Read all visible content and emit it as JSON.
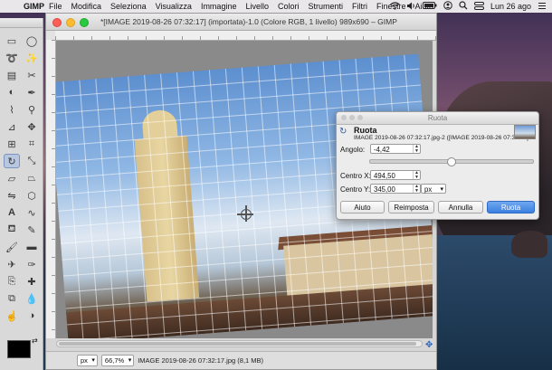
{
  "menubar": {
    "app": "GIMP",
    "items": [
      "File",
      "Modifica",
      "Seleziona",
      "Visualizza",
      "Immagine",
      "Livello",
      "Colori",
      "Strumenti",
      "Filtri",
      "Finestre",
      "Aiuto"
    ],
    "clock": "Lun 26 ago"
  },
  "window": {
    "title": "*[IMAGE 2019-08-26 07:32:17] (importata)-1.0 (Colore RGB, 1 livello) 989x690 – GIMP"
  },
  "statusbar": {
    "unit": "px",
    "zoom": "66,7%",
    "info": "IMAGE 2019-08-26 07:32:17.jpg (8,1 MB)"
  },
  "dialog": {
    "window_title": "Ruota",
    "heading": "Ruota",
    "subtitle": "IMAGE 2019-08-26 07:32:17.jpg-2 ([IMAGE 2019-08-26 07:32:17] ...",
    "angle_label": "Angolo:",
    "angle_value": "-4,42",
    "center_x_label": "Centro X:",
    "center_x_value": "494,50",
    "center_y_label": "Centro Y:",
    "center_y_value": "345,00",
    "unit": "px",
    "buttons": {
      "help": "Aiuto",
      "reset": "Reimposta",
      "cancel": "Annulla",
      "rotate": "Ruota"
    }
  },
  "colors": {
    "accent": "#3b7fe0",
    "close": "#fc5f57",
    "minimize": "#fdbc2e",
    "maximize": "#28c840"
  }
}
